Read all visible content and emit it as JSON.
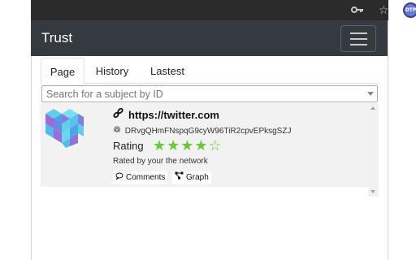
{
  "browser": {
    "icons": [
      "key-icon",
      "star-icon"
    ],
    "avatar_text": "DTP"
  },
  "navbar": {
    "brand": "Trust",
    "toggler_icon": "hamburger-icon"
  },
  "tabs": [
    {
      "label": "Page",
      "active": true
    },
    {
      "label": "History",
      "active": false
    },
    {
      "label": "Lastest",
      "active": false
    }
  ],
  "search": {
    "placeholder": "Search for a subject by ID"
  },
  "result": {
    "title": "https://twitter.com",
    "id": "DRvgQHmFNspqG9cyW96TiR2cpvEPksgSZJ",
    "rating_label": "Rating",
    "rating": 4,
    "rating_max": 5,
    "stars_filled": "★★★★",
    "stars_empty": "☆",
    "network_text": "Rated by your the network",
    "comments_label": "Comments",
    "graph_label": "Graph",
    "star_color": "#66cc33"
  },
  "colors": {
    "navbar_bg": "#343a40",
    "chrome_bg": "#2b2b2b",
    "result_bg": "#f2f2f2"
  }
}
